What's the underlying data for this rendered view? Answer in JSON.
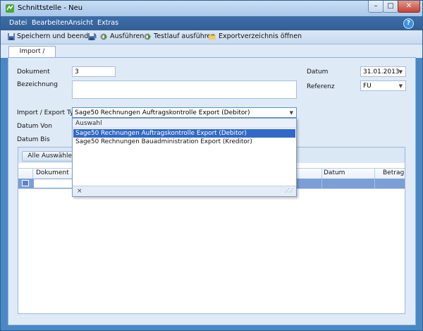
{
  "window": {
    "title": "Schnittstelle - Neu",
    "min": "–",
    "max": "□",
    "close": "✕"
  },
  "menu": {
    "items": [
      "Datei",
      "Bearbeiten",
      "Ansicht",
      "Extras"
    ],
    "help": "?"
  },
  "toolbar": {
    "save_close": "Speichern und beenden",
    "run": "Ausführen",
    "test_run": "Testlauf ausführen",
    "export_dir": "Exportverzeichnis öffnen"
  },
  "tab": {
    "label": "Import / Export"
  },
  "form": {
    "dokument_label": "Dokument",
    "dokument_value": "3",
    "bezeichnung_label": "Bezeichnung",
    "bezeichnung_value": "",
    "datum_label": "Datum",
    "datum_value": "31.01.2013",
    "referenz_label": "Referenz",
    "referenz_value": "FU",
    "typ_label": "Import / Export Typ",
    "typ_value": "Sage50 Rechnungen Auftragskontrolle Export (Debitor)",
    "datum_von_label": "Datum Von",
    "datum_bis_label": "Datum Bis"
  },
  "dropdown": {
    "header": "Auswahl",
    "options": [
      "Sage50 Rechnungen Auftragskontrolle Export (Debitor)",
      "Sage50 Rechnungen Bauadministration Export (Kreditor)"
    ],
    "selected_index": 0,
    "close": "×",
    "grip": "⋰⋰"
  },
  "grid": {
    "select_all": "Alle Auswählen",
    "columns": [
      "Dokument",
      "Datum",
      "Betrag"
    ]
  },
  "colors": {
    "accent": "#3169c6",
    "window_frame": "#4a88c4",
    "selected_row": "#7c9ed6"
  },
  "icons": [
    "app-icon",
    "save-close-icon",
    "save-icon",
    "run-icon",
    "test-run-icon",
    "folder-icon",
    "help-icon",
    "chevron-down-icon"
  ]
}
